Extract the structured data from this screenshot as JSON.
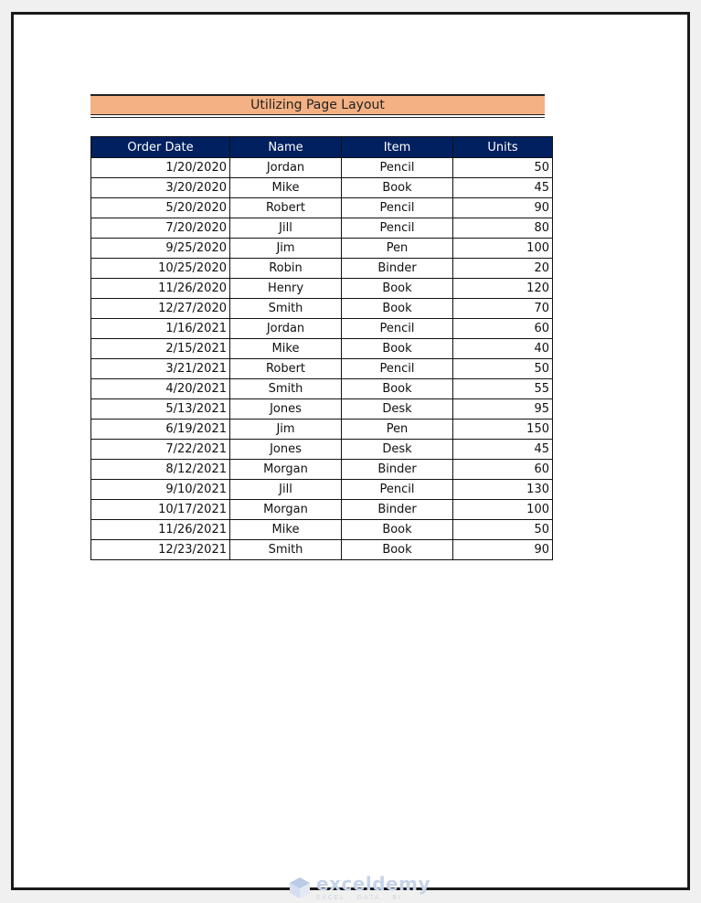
{
  "sheet": {
    "title": "Utilizing Page Layout",
    "columns": [
      "Order Date",
      "Name",
      "Item",
      "Units"
    ],
    "rows": [
      [
        "1/20/2020",
        "Jordan",
        "Pencil",
        "50"
      ],
      [
        "3/20/2020",
        "Mike",
        "Book",
        "45"
      ],
      [
        "5/20/2020",
        "Robert",
        "Pencil",
        "90"
      ],
      [
        "7/20/2020",
        "Jill",
        "Pencil",
        "80"
      ],
      [
        "9/25/2020",
        "Jim",
        "Pen",
        "100"
      ],
      [
        "10/25/2020",
        "Robin",
        "Binder",
        "20"
      ],
      [
        "11/26/2020",
        "Henry",
        "Book",
        "120"
      ],
      [
        "12/27/2020",
        "Smith",
        "Book",
        "70"
      ],
      [
        "1/16/2021",
        "Jordan",
        "Pencil",
        "60"
      ],
      [
        "2/15/2021",
        "Mike",
        "Book",
        "40"
      ],
      [
        "3/21/2021",
        "Robert",
        "Pencil",
        "50"
      ],
      [
        "4/20/2021",
        "Smith",
        "Book",
        "55"
      ],
      [
        "5/13/2021",
        "Jones",
        "Desk",
        "95"
      ],
      [
        "6/19/2021",
        "Jim",
        "Pen",
        "150"
      ],
      [
        "7/22/2021",
        "Jones",
        "Desk",
        "45"
      ],
      [
        "8/12/2021",
        "Morgan",
        "Binder",
        "60"
      ],
      [
        "9/10/2021",
        "Jill",
        "Pencil",
        "130"
      ],
      [
        "10/17/2021",
        "Morgan",
        "Binder",
        "100"
      ],
      [
        "11/26/2021",
        "Mike",
        "Book",
        "50"
      ],
      [
        "12/23/2021",
        "Smith",
        "Book",
        "90"
      ]
    ]
  },
  "colors": {
    "title_fill": "#f4b183",
    "header_fill": "#002060",
    "header_text": "#ffffff"
  },
  "watermark": {
    "icon": "exceldemy-logo-icon",
    "name": "exceldemy",
    "tagline": "EXCEL · DATA · BI"
  }
}
